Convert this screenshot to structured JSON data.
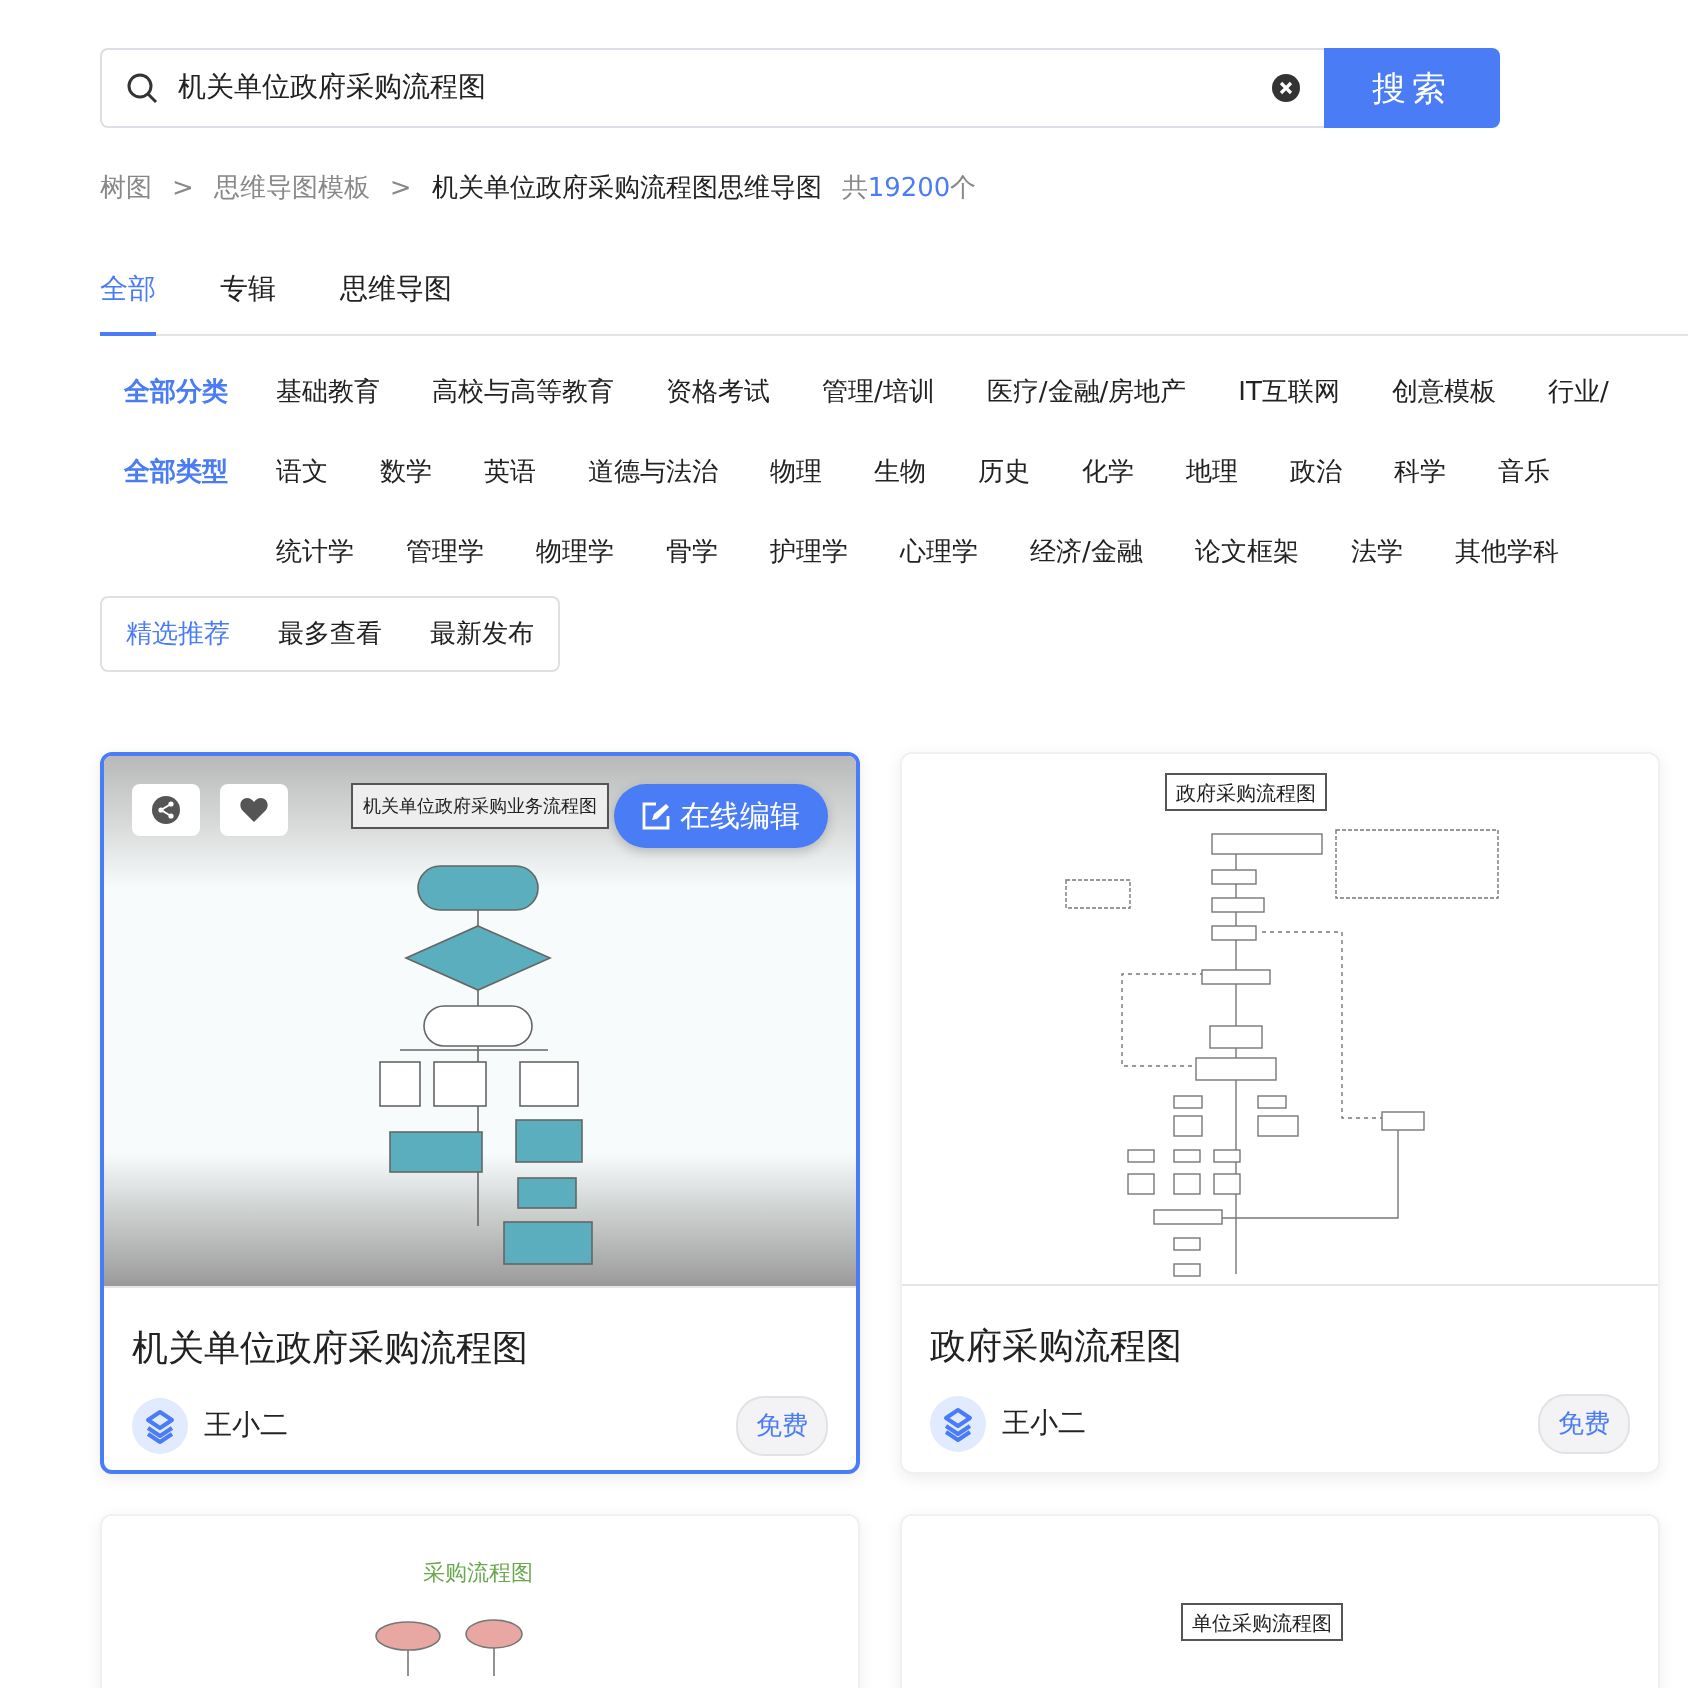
{
  "search": {
    "value": "机关单位政府采购流程图",
    "button": "搜索"
  },
  "breadcrumb": [
    {
      "kind": "link",
      "text": "树图"
    },
    {
      "kind": "sep",
      "text": ">"
    },
    {
      "kind": "link",
      "text": "思维导图模板"
    },
    {
      "kind": "sep",
      "text": ">"
    },
    {
      "kind": "current",
      "text": "机关单位政府采购流程图思维导图"
    }
  ],
  "result_count": {
    "prefix": "共",
    "count": "19200",
    "suffix": "个"
  },
  "tabs": [
    {
      "label": "全部",
      "selected": true
    },
    {
      "label": "专辑",
      "selected": false
    },
    {
      "label": "思维导图",
      "selected": false
    }
  ],
  "filters": [
    {
      "label": "全部分类",
      "lines": [
        [
          "基础教育",
          "高校与高等教育",
          "资格考试",
          "管理/培训",
          "医疗/金融/房地产",
          "IT互联网",
          "创意模板",
          "行业/"
        ]
      ]
    },
    {
      "label": "全部类型",
      "lines": [
        [
          "语文",
          "数学",
          "英语",
          "道德与法治",
          "物理",
          "生物",
          "历史",
          "化学",
          "地理",
          "政治",
          "科学",
          "音乐"
        ],
        [
          "统计学",
          "管理学",
          "物理学",
          "骨学",
          "护理学",
          "心理学",
          "经济/金融",
          "论文框架",
          "法学",
          "其他学科"
        ]
      ]
    }
  ],
  "sort": [
    {
      "label": "精选推荐",
      "selected": true
    },
    {
      "label": "最多查看",
      "selected": false
    },
    {
      "label": "最新发布",
      "selected": false
    }
  ],
  "cards": [
    {
      "kind": "teal",
      "selected": true,
      "diagram_title": "机关单位政府采购业务流程图",
      "title": "机关单位政府采购流程图",
      "author": "王小二",
      "price": "免费",
      "edit": "在线编辑"
    },
    {
      "kind": "mono",
      "selected": false,
      "diagram_title": "政府采购流程图",
      "title": "政府采购流程图",
      "author": "王小二",
      "price": "免费"
    },
    {
      "kind": "pink",
      "selected": false,
      "diagram_title": "采购流程图"
    },
    {
      "kind": "plain",
      "selected": false,
      "diagram_title": "单位采购流程图"
    }
  ]
}
